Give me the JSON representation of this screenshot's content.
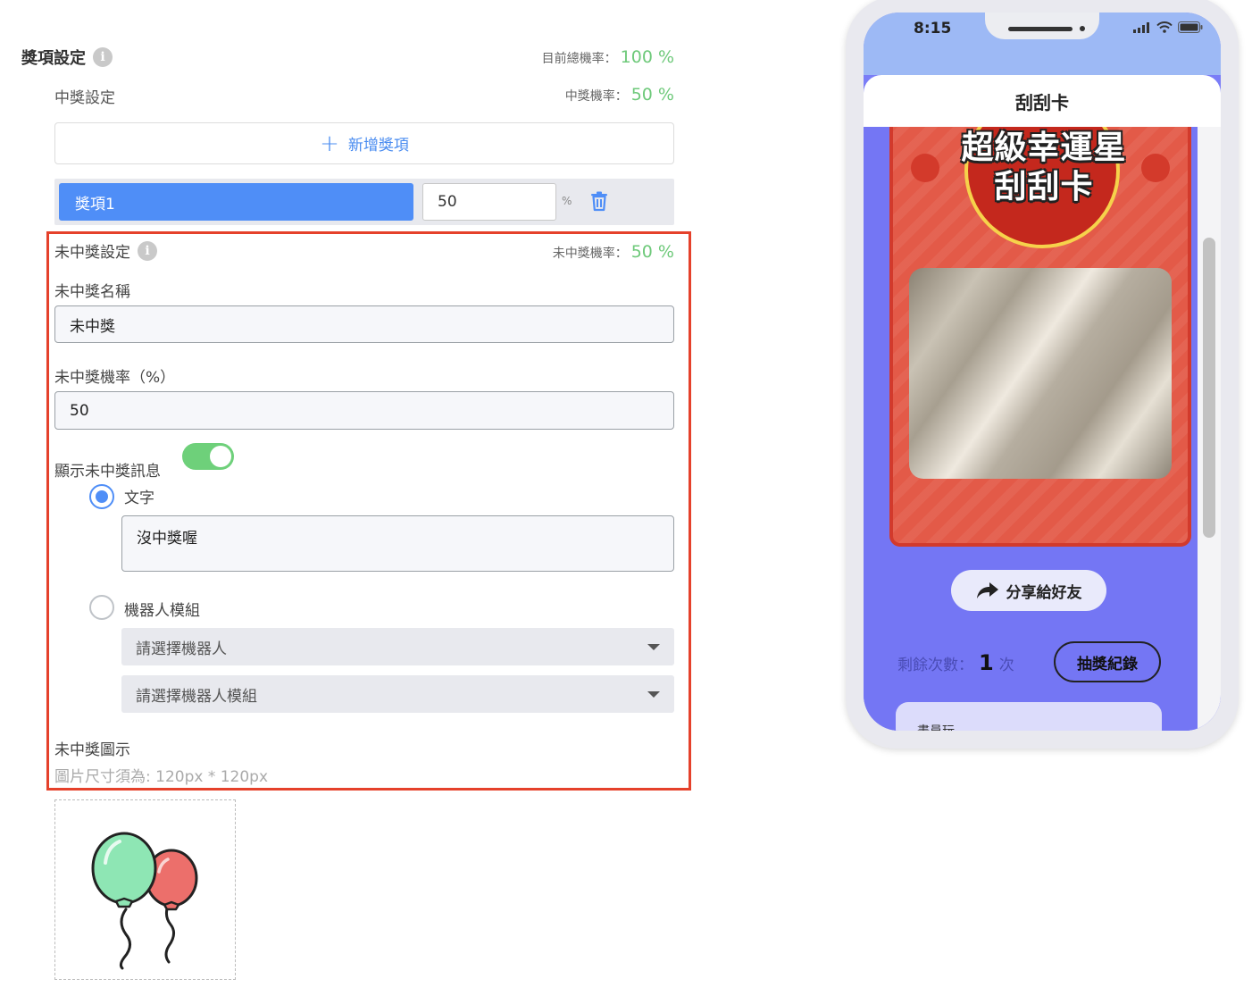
{
  "settings": {
    "title": "獎項設定",
    "total_rate_label": "目前總機率：",
    "total_rate_value": "100 %",
    "win": {
      "title": "中獎設定",
      "rate_label": "中獎機率：",
      "rate_value": "50 %",
      "add_label": "新增獎項",
      "prizes": [
        {
          "name": "獎項1",
          "value": "50",
          "unit": "%"
        }
      ]
    },
    "lose": {
      "title": "未中獎設定",
      "rate_label": "未中獎機率：",
      "rate_value": "50 %",
      "name_label": "未中獎名稱",
      "name_value": "未中獎",
      "prob_label": "未中獎機率（%）",
      "prob_value": "50",
      "show_msg_label": "顯示未中獎訊息",
      "show_msg_enabled": true,
      "option_text_label": "文字",
      "option_text_value": "沒中獎喔",
      "option_bot_label": "機器人模組",
      "bot_select_placeholder": "請選擇機器人",
      "bot_module_placeholder": "請選擇機器人模組",
      "icon_label": "未中獎圖示",
      "icon_hint": "圖片尺寸須為: 120px * 120px"
    }
  },
  "phone": {
    "time": "8:15",
    "header_title": "刮刮卡",
    "card_title_line1": "超級幸運星",
    "card_title_line2": "刮刮卡",
    "share_label": "分享給好友",
    "remain_label": "剩餘次數：",
    "remain_count": "1",
    "remain_unit": "次",
    "record_label": "抽獎紀錄",
    "list_preview": "畫員玩"
  },
  "colors": {
    "accent": "#4f8ef7",
    "rate_green": "#6ec97a",
    "highlight_border": "#e5412b",
    "card_red": "#e35a48",
    "phone_bg": "#7476f4"
  }
}
